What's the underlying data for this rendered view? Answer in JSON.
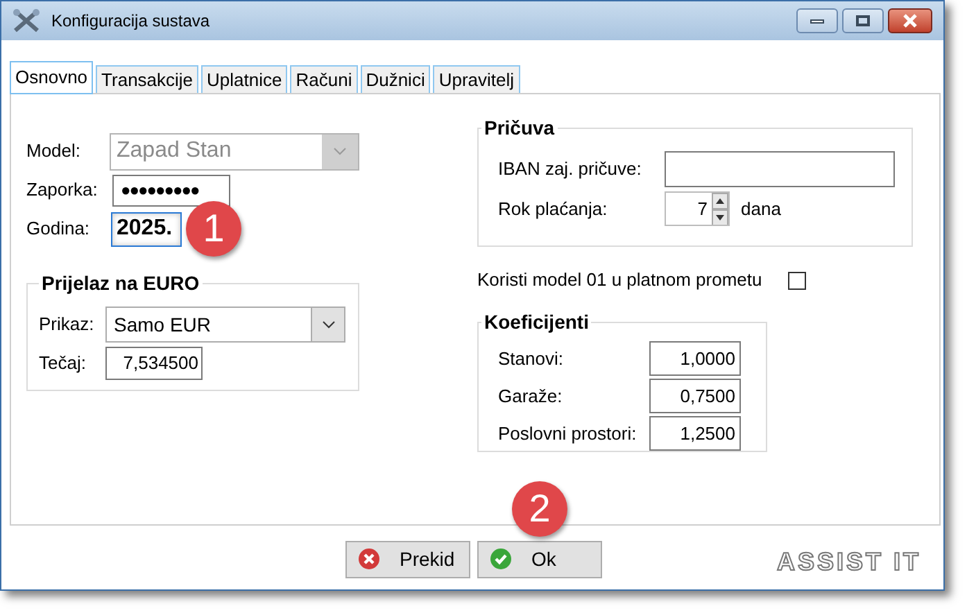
{
  "window": {
    "title": "Konfiguracija sustava"
  },
  "tabs": [
    {
      "label": "Osnovno",
      "selected": true
    },
    {
      "label": "Transakcije",
      "selected": false
    },
    {
      "label": "Uplatnice",
      "selected": false
    },
    {
      "label": "Računi",
      "selected": false
    },
    {
      "label": "Dužnici",
      "selected": false
    },
    {
      "label": "Upravitelj",
      "selected": false
    }
  ],
  "model": {
    "label": "Model:",
    "value": "Zapad Stan",
    "disabled": true
  },
  "password": {
    "label": "Zaporka:",
    "value": "●●●●●●●●●"
  },
  "year": {
    "label": "Godina:",
    "value": "2025.",
    "focused": true
  },
  "euro_group": {
    "title": "Prijelaz na EURO",
    "display": {
      "label": "Prikaz:",
      "value": "Samo EUR"
    },
    "rate": {
      "label": "Tečaj:",
      "value": "7,534500"
    }
  },
  "reserve_group": {
    "title": "Pričuva",
    "iban": {
      "label": "IBAN zaj. pričuve:"
    },
    "payment_term": {
      "label": "Rok plaćanja:",
      "value": "7",
      "unit": "dana"
    }
  },
  "model01": {
    "label": "Koristi model 01 u platnom prometu",
    "checked": false
  },
  "coefficients": {
    "title": "Koeficijenti",
    "rows": [
      {
        "label": "Stanovi:",
        "value": "1,0000"
      },
      {
        "label": "Garaže:",
        "value": "0,7500"
      },
      {
        "label": "Poslovni prostori:",
        "value": "1,2500"
      }
    ]
  },
  "buttons": [
    {
      "label": "Prekid",
      "kind": "cancel"
    },
    {
      "label": "Ok",
      "kind": "ok"
    }
  ],
  "markers": [
    "1",
    "2"
  ],
  "logo": "ASSIST IT"
}
